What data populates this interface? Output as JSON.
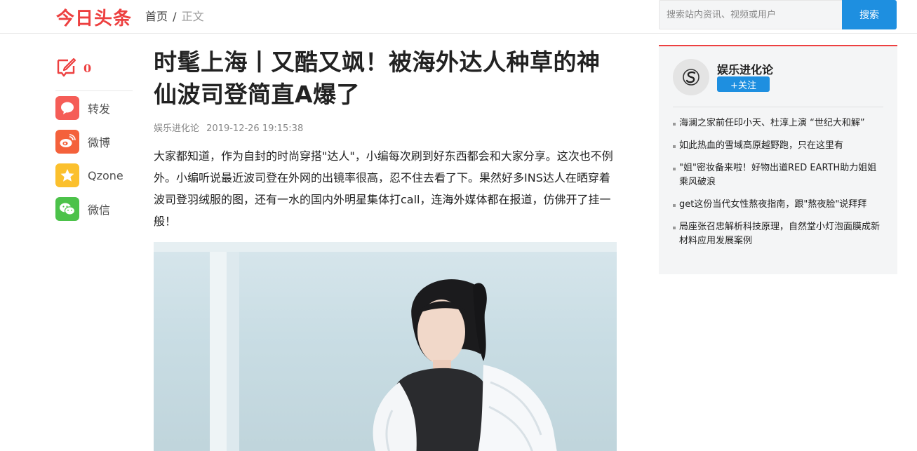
{
  "header": {
    "logo": "今日头条",
    "crumb_home": "首页",
    "crumb_sep": "/",
    "crumb_current": "正文",
    "search_placeholder": "搜索站内资讯、视频或用户",
    "search_button": "搜索"
  },
  "share": {
    "comment_count": "0",
    "items": [
      {
        "label": "转发",
        "icon": "repost-icon",
        "color": "#f55d57"
      },
      {
        "label": "微博",
        "icon": "weibo-icon",
        "color": "#f4613b"
      },
      {
        "label": "Qzone",
        "icon": "qzone-icon",
        "color": "#fbc02d"
      },
      {
        "label": "微信",
        "icon": "wechat-icon",
        "color": "#4cc24a"
      }
    ]
  },
  "article": {
    "title": "时髦上海丨又酷又飒！被海外达人种草的神仙波司登简直A爆了",
    "author": "娱乐进化论",
    "datetime": "2019-12-26 19:15:38",
    "paragraph": "大家都知道，作为自封的时尚穿搭\"达人\"，小编每次刷到好东西都会和大家分享。这次也不例外。小编听说最近波司登在外网的出镜率很高，忍不住去看了下。果然好多INS达人在晒穿着波司登羽绒服的图，还有一水的国内外明星集体打call，连海外媒体都在报道，仿佛开了挂一般！"
  },
  "sidebar": {
    "author_name": "娱乐进化论",
    "follow_label": "+关注",
    "related": [
      "海澜之家前任印小天、杜淳上演 “世纪大和解”",
      "如此热血的雪域高原越野跑，只在这里有",
      "\"姐\"密妆备来啦！好物出道RED EARTH助力姐姐乘风破浪",
      "get这份当代女性熬夜指南，跟\"熬夜脸\"说拜拜",
      "局座张召忠解析科技原理，自然堂小灯泡面膜成新材料应用发展案例"
    ]
  },
  "colors": {
    "brand_red": "#ed4040",
    "accent_blue": "#1e8fe0"
  }
}
